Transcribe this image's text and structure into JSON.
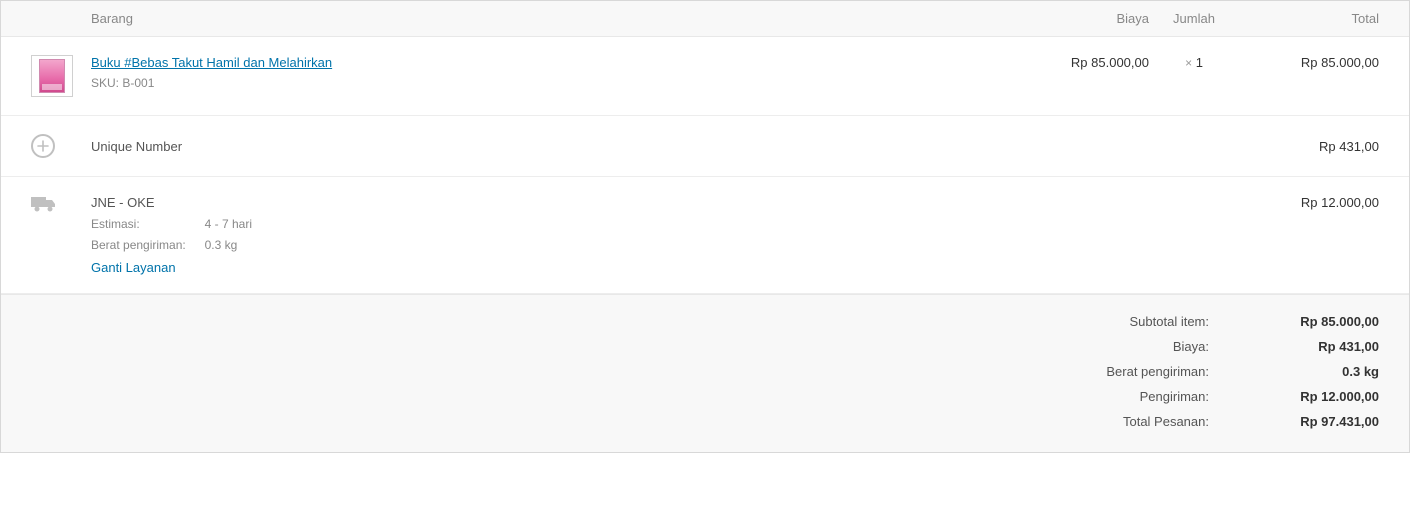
{
  "header": {
    "item": "Barang",
    "cost": "Biaya",
    "qty": "Jumlah",
    "total": "Total"
  },
  "product": {
    "name": "Buku #Bebas Takut Hamil dan Melahirkan",
    "sku_label": "SKU:",
    "sku_value": "B-001",
    "cost": "Rp 85.000,00",
    "qty_prefix": "×",
    "qty": "1",
    "total": "Rp 85.000,00"
  },
  "extra": {
    "name": "Unique Number",
    "total": "Rp 431,00"
  },
  "shipping": {
    "name": "JNE - OKE",
    "estimate_label": "Estimasi:",
    "estimate_value": "4 - 7 hari",
    "weight_label": "Berat pengiriman:",
    "weight_value": "0.3 kg",
    "change_label": "Ganti Layanan",
    "total": "Rp 12.000,00"
  },
  "summary": {
    "subtotal_label": "Subtotal item:",
    "subtotal_value": "Rp 85.000,00",
    "fee_label": "Biaya:",
    "fee_value": "Rp 431,00",
    "weight_label": "Berat pengiriman:",
    "weight_value": "0.3 kg",
    "shipping_label": "Pengiriman:",
    "shipping_value": "Rp 12.000,00",
    "total_label": "Total Pesanan:",
    "total_value": "Rp 97.431,00"
  }
}
